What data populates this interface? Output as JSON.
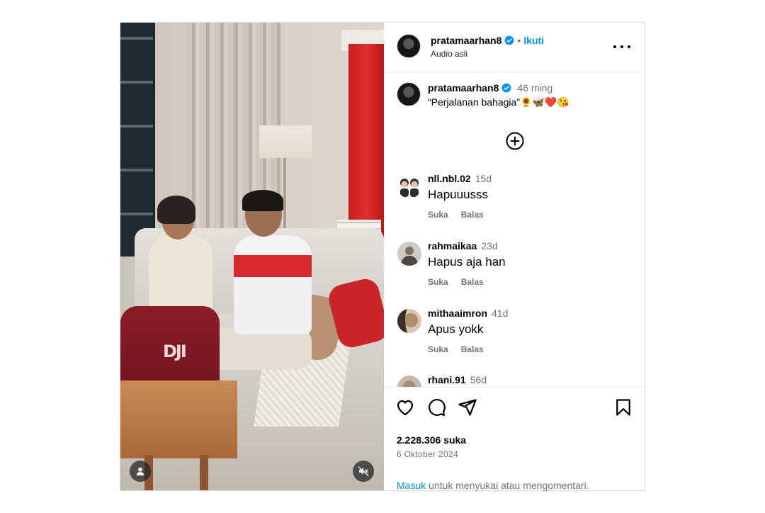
{
  "post": {
    "author": "pratamaarhan8",
    "follow_label": "Ikuti",
    "audio_label": "Audio asli",
    "caption_time": "46 ming",
    "caption_text": "“Perjalanan bahagia”🌻🦋❤️😘",
    "likes": "2.228.306 suka",
    "date": "6 Oktober 2024"
  },
  "comments": [
    {
      "user": "nll.nbl.02",
      "time": "15d",
      "text": "Hapuuusss",
      "like_label": "Suka",
      "reply_label": "Balas"
    },
    {
      "user": "rahmaikaa",
      "time": "23d",
      "text": "Hapus aja han",
      "like_label": "Suka",
      "reply_label": "Balas"
    },
    {
      "user": "mithaaimron",
      "time": "41d",
      "text": "Apus yokk",
      "like_label": "Suka",
      "reply_label": "Balas"
    },
    {
      "user": "rhani.91",
      "time": "56d",
      "text": "",
      "like_label": "",
      "reply_label": ""
    }
  ],
  "login": {
    "link_label": "Masuk",
    "rest": " untuk menyukai atau mengomentari."
  },
  "icons": {
    "like": "heart-icon",
    "comment": "comment-icon",
    "share": "paper-plane-icon",
    "save": "bookmark-icon",
    "more": "more-options-icon",
    "user_tag": "user-tag-icon",
    "mute": "muted-speaker-icon",
    "load_more": "plus-circle-icon",
    "verified": "verified-badge-icon"
  },
  "colors": {
    "link_blue": "#0095f6",
    "verified_blue": "#0095f6",
    "muted_text": "#737373",
    "border": "#dbdbdb"
  }
}
